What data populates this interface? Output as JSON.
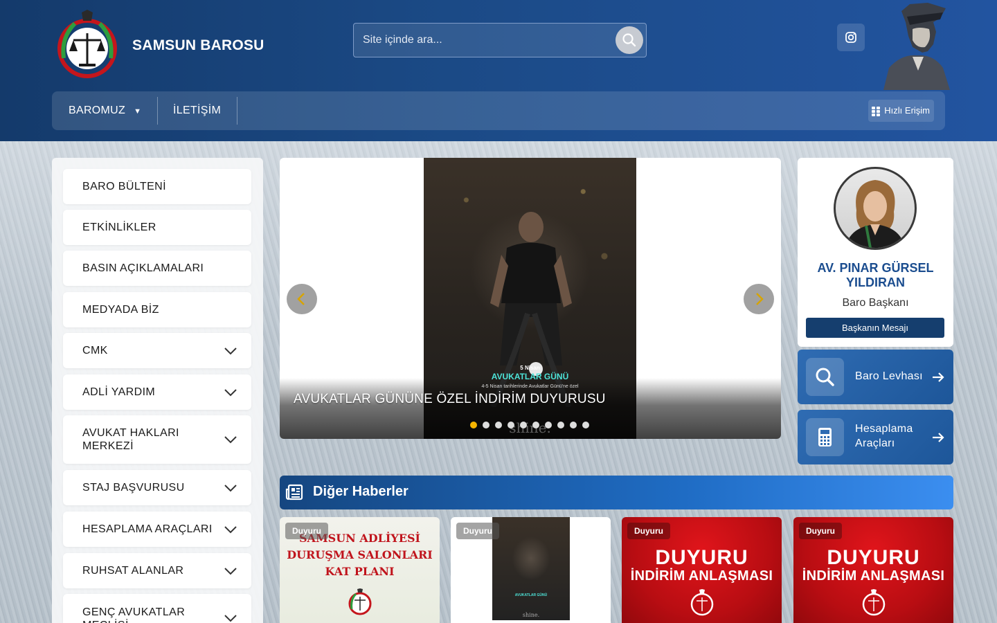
{
  "header": {
    "brand": "SAMSUN BAROSU",
    "search_placeholder": "Site içinde ara...",
    "nav": [
      {
        "label": "BAROMUZ"
      },
      {
        "label": "İLETİŞİM"
      }
    ],
    "quick_access": "Hızlı Erişim",
    "logo_text": "SAMSUN BAROSU"
  },
  "sidebar": {
    "items": [
      {
        "label": "BARO BÜLTENİ"
      },
      {
        "label": "ETKİNLİKLER"
      },
      {
        "label": "BASIN AÇIKLAMALARI"
      },
      {
        "label": "MEDYADA BİZ"
      },
      {
        "label": "CMK"
      },
      {
        "label": "ADLİ YARDIM"
      },
      {
        "label": "AVUKAT HAKLARI MERKEZİ"
      },
      {
        "label": "STAJ BAŞVURUSU"
      },
      {
        "label": "HESAPLAMA ARAÇLARI"
      },
      {
        "label": "RUHSAT ALANLAR"
      },
      {
        "label": "GENÇ AVUKATLAR MECLİSİ"
      }
    ]
  },
  "slider": {
    "caption": "AVUKATLAR GÜNÜNE ÖZEL İNDİRİM DUYURUSU",
    "image_date": "5 Nisan",
    "image_title": "AVUKATLAR GÜNÜ",
    "image_sub": "4-5 Nisan tarihlerinde Avukatlar Günü'ne özel",
    "image_brand": "shine.",
    "slide_count": 10,
    "active_index": 0
  },
  "president": {
    "name": "AV. PINAR GÜRSEL YILDIRAN",
    "title": "Baro Başkanı",
    "button": "Başkanın Mesajı"
  },
  "tools": [
    {
      "label": "Baro Levhası",
      "icon": "search-icon"
    },
    {
      "label": "Hesaplama Araçları",
      "icon": "calculator-icon"
    }
  ],
  "news": {
    "heading": "Diğer Haberler",
    "cards": [
      {
        "tag": "Duyuru",
        "lines": [
          "SAMSUN ADLİYESİ",
          "DURUŞMA SALONLARI",
          "KAT PLANI"
        ]
      },
      {
        "tag": "Duyuru",
        "image_title": "AVUKATLAR GÜNÜ",
        "image_brand": "shine."
      },
      {
        "tag": "Duyuru",
        "big": "DUYURU",
        "small": "İNDİRİM ANLAŞMASI"
      },
      {
        "tag": "Duyuru",
        "big": "DUYURU",
        "small": "İNDİRİM ANLAŞMASI"
      }
    ]
  },
  "colors": {
    "header_dark": "#143a6b",
    "accent_blue": "#1b4d8f",
    "button_navy": "#153e6e",
    "dot_active": "#f5b400",
    "red_card": "#c8101a"
  }
}
